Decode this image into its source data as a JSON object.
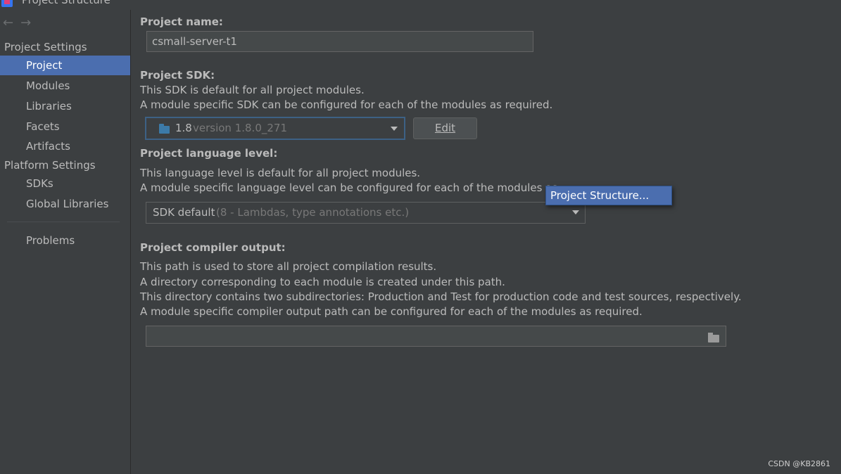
{
  "window": {
    "title": "Project Structure"
  },
  "nav": {
    "back": "←",
    "forward": "→"
  },
  "sidebar": {
    "project_settings_header": "Project Settings",
    "platform_settings_header": "Platform Settings",
    "items": [
      {
        "label": "Project"
      },
      {
        "label": "Modules"
      },
      {
        "label": "Libraries"
      },
      {
        "label": "Facets"
      },
      {
        "label": "Artifacts"
      },
      {
        "label": "SDKs"
      },
      {
        "label": "Global Libraries"
      },
      {
        "label": "Problems"
      }
    ]
  },
  "main": {
    "project_name_label": "Project name:",
    "project_name_value": "csmall-server-t1",
    "sdk_label": "Project SDK:",
    "sdk_desc1": "This SDK is default for all project modules.",
    "sdk_desc2": "A module specific SDK can be configured for each of the modules as required.",
    "sdk_selected": "1.8",
    "sdk_version": "version 1.8.0_271",
    "edit_button": "Edit",
    "lang_label": "Project language level:",
    "lang_desc1": "This language level is default for all project modules.",
    "lang_desc2": "A module specific language level can be configured for each of the modules as",
    "lang_selected": "SDK default",
    "lang_detail": "(8 - Lambdas, type annotations etc.)",
    "output_label": "Project compiler output:",
    "output_desc1": "This path is used to store all project compilation results.",
    "output_desc2": "A directory corresponding to each module is created under this path.",
    "output_desc3": "This directory contains two subdirectories: Production and Test for production code and test sources, respectively.",
    "output_desc4": "A module specific compiler output path can be configured for each of the modules as required.",
    "output_value": ""
  },
  "popup": {
    "item": "Project Structure..."
  },
  "watermark": "CSDN @KB2861",
  "colors": {
    "selection": "#4b6eaf",
    "background": "#3c3f41"
  }
}
